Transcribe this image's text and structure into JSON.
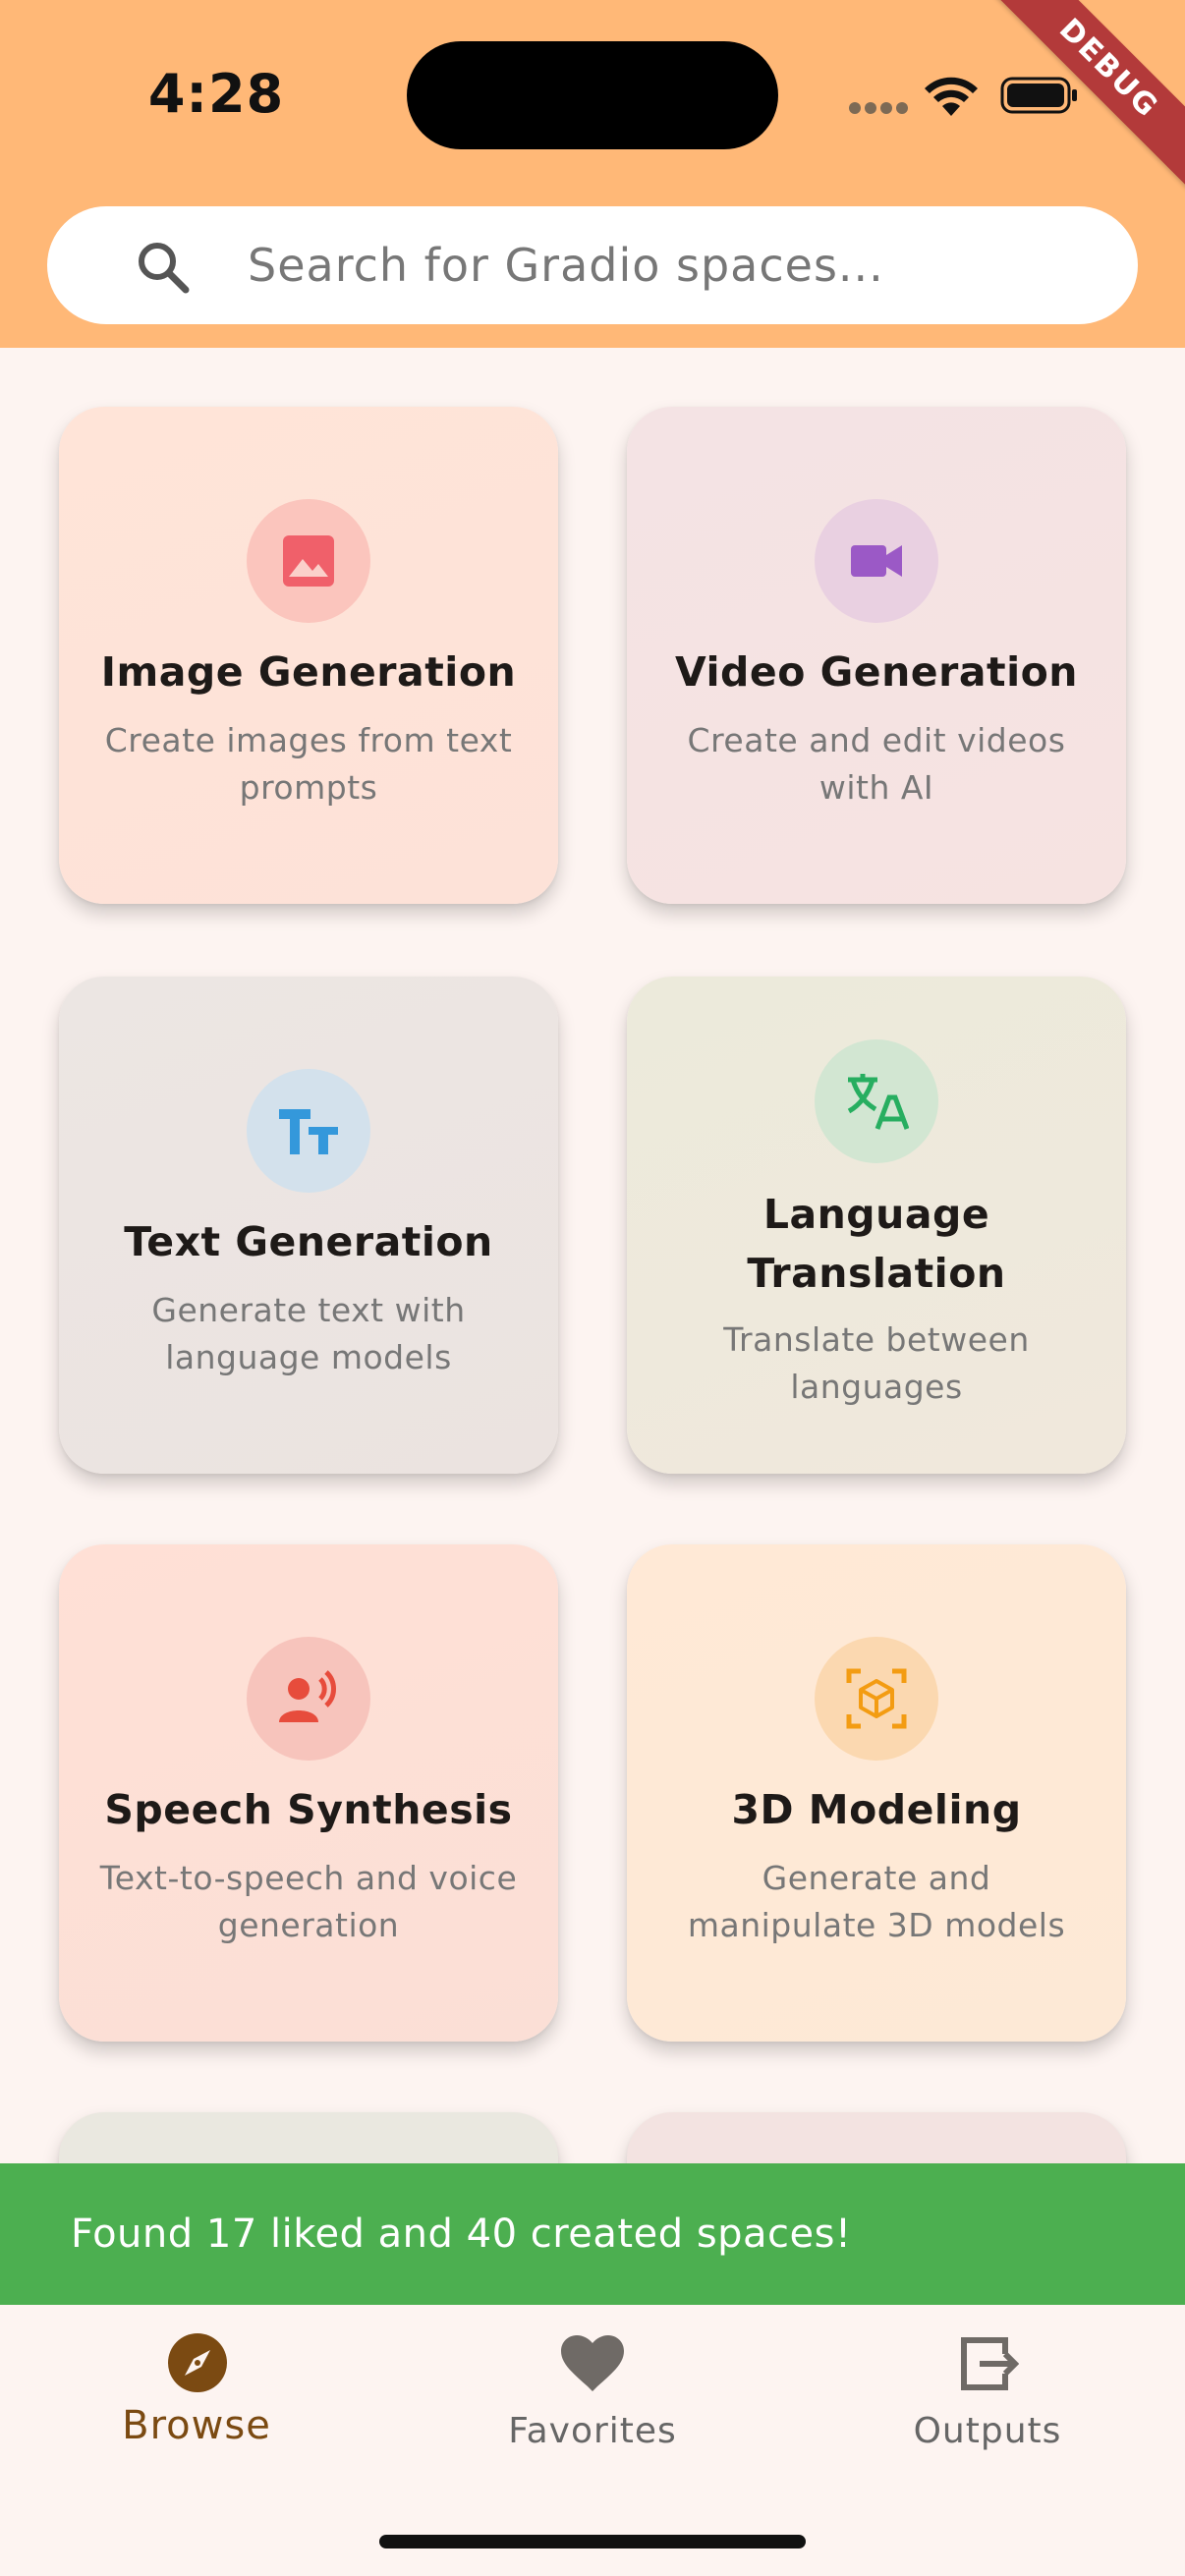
{
  "status_bar": {
    "time": "4:28",
    "debug_label": "DEBUG"
  },
  "search": {
    "placeholder": "Search for Gradio spaces..."
  },
  "cards": [
    {
      "title": "Image Generation",
      "description": "Create images from text prompts",
      "icon": "image-icon",
      "icon_color": "#f0606a"
    },
    {
      "title": "Video Generation",
      "description": "Create and edit videos with AI",
      "icon": "videocam-icon",
      "icon_color": "#9b59c6"
    },
    {
      "title": "Text Generation",
      "description": "Generate text with language models",
      "icon": "text-fields-icon",
      "icon_color": "#3498db"
    },
    {
      "title": "Language Translation",
      "description": "Translate between languages",
      "icon": "translate-icon",
      "icon_color": "#27ae60"
    },
    {
      "title": "Speech Synthesis",
      "description": "Text-to-speech and voice generation",
      "icon": "record-voice-icon",
      "icon_color": "#e74c3c"
    },
    {
      "title": "3D Modeling",
      "description": "Generate and manipulate 3D models",
      "icon": "view-in-ar-icon",
      "icon_color": "#f39c12"
    }
  ],
  "toast": {
    "message": "Found 17 liked and 40 created spaces!"
  },
  "bottom_nav": {
    "items": [
      {
        "label": "Browse",
        "icon": "explore-icon",
        "active": true
      },
      {
        "label": "Favorites",
        "icon": "heart-icon",
        "active": false
      },
      {
        "label": "Outputs",
        "icon": "output-icon",
        "active": false
      }
    ]
  },
  "colors": {
    "header": "#ffb877",
    "accent": "#7b4a12",
    "toast": "#4caf50"
  }
}
